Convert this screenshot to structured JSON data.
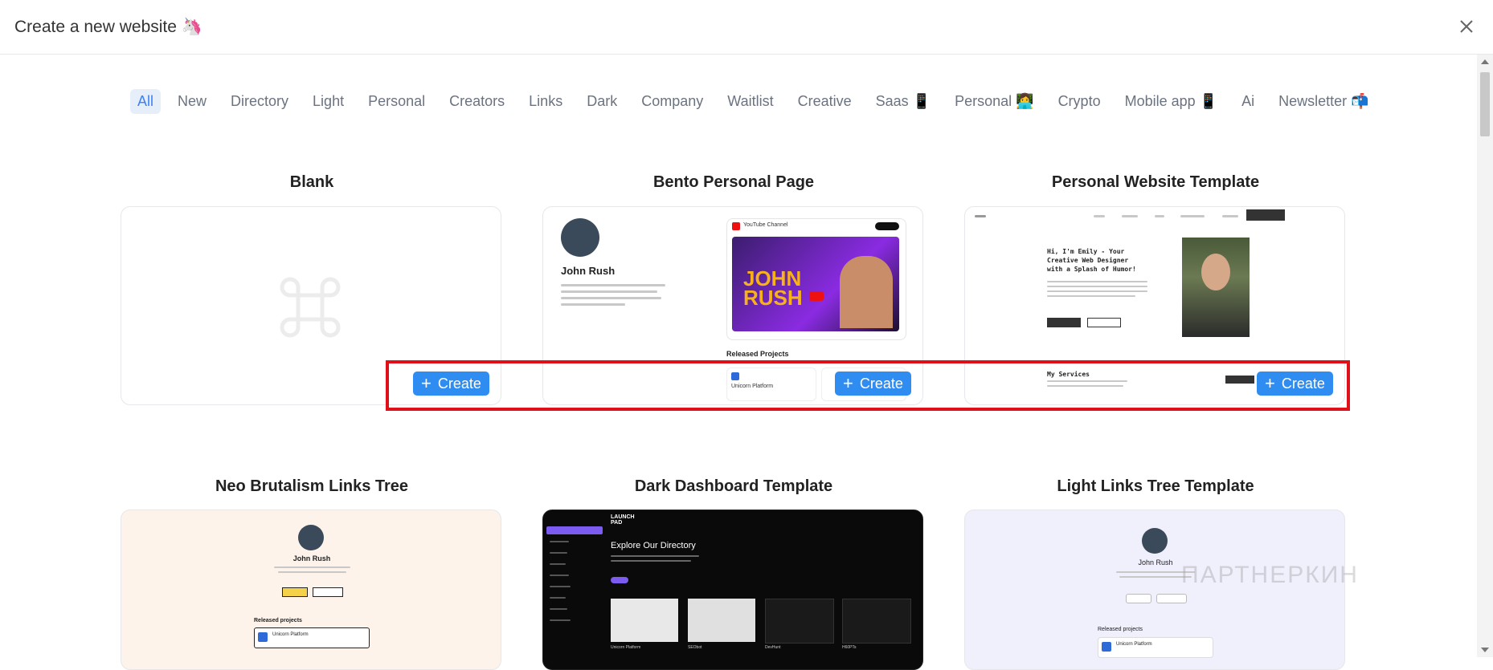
{
  "header": {
    "title": "Create a new website 🦄"
  },
  "filters": [
    {
      "label": "All",
      "active": true
    },
    {
      "label": "New"
    },
    {
      "label": "Directory"
    },
    {
      "label": "Light"
    },
    {
      "label": "Personal"
    },
    {
      "label": "Creators"
    },
    {
      "label": "Links"
    },
    {
      "label": "Dark"
    },
    {
      "label": "Company"
    },
    {
      "label": "Waitlist"
    },
    {
      "label": "Creative"
    },
    {
      "label": "Saas 📱"
    },
    {
      "label": "Personal 👩‍💻"
    },
    {
      "label": "Crypto"
    },
    {
      "label": "Mobile app 📱"
    },
    {
      "label": "Ai"
    },
    {
      "label": "Newsletter 📬"
    }
  ],
  "create_label": "Create",
  "templates": [
    {
      "title": "Blank"
    },
    {
      "title": "Bento Personal Page",
      "preview": {
        "name": "John Rush",
        "video_channel": "YouTube Channel",
        "video_title": "JOHN RUSH",
        "section": "Released Projects",
        "item": "Unicorn Platform"
      }
    },
    {
      "title": "Personal Website Template",
      "preview": {
        "headline": "Hi, I'm Emily - Your Creative Web Designer with a Splash of Humor!",
        "section": "My Services"
      }
    },
    {
      "title": "Neo Brutalism Links Tree",
      "preview": {
        "name": "John Rush",
        "section": "Released projects",
        "item": "Unicorn Platform"
      }
    },
    {
      "title": "Dark Dashboard Template",
      "preview": {
        "logo": "LAUNCH PAD",
        "headline": "Explore Our Directory",
        "cards": [
          "Unicorn Platform",
          "SEObot",
          "DevHunt",
          "H60PTs"
        ]
      }
    },
    {
      "title": "Light Links Tree Template",
      "preview": {
        "name": "John Rush",
        "section": "Released projects",
        "item": "Unicorn Platform"
      }
    }
  ],
  "watermark": "ПАРТНЕРКИН",
  "colors": {
    "accent": "#2f8cf1",
    "highlight": "#e0101a",
    "active_chip_bg": "#e6eef9"
  }
}
